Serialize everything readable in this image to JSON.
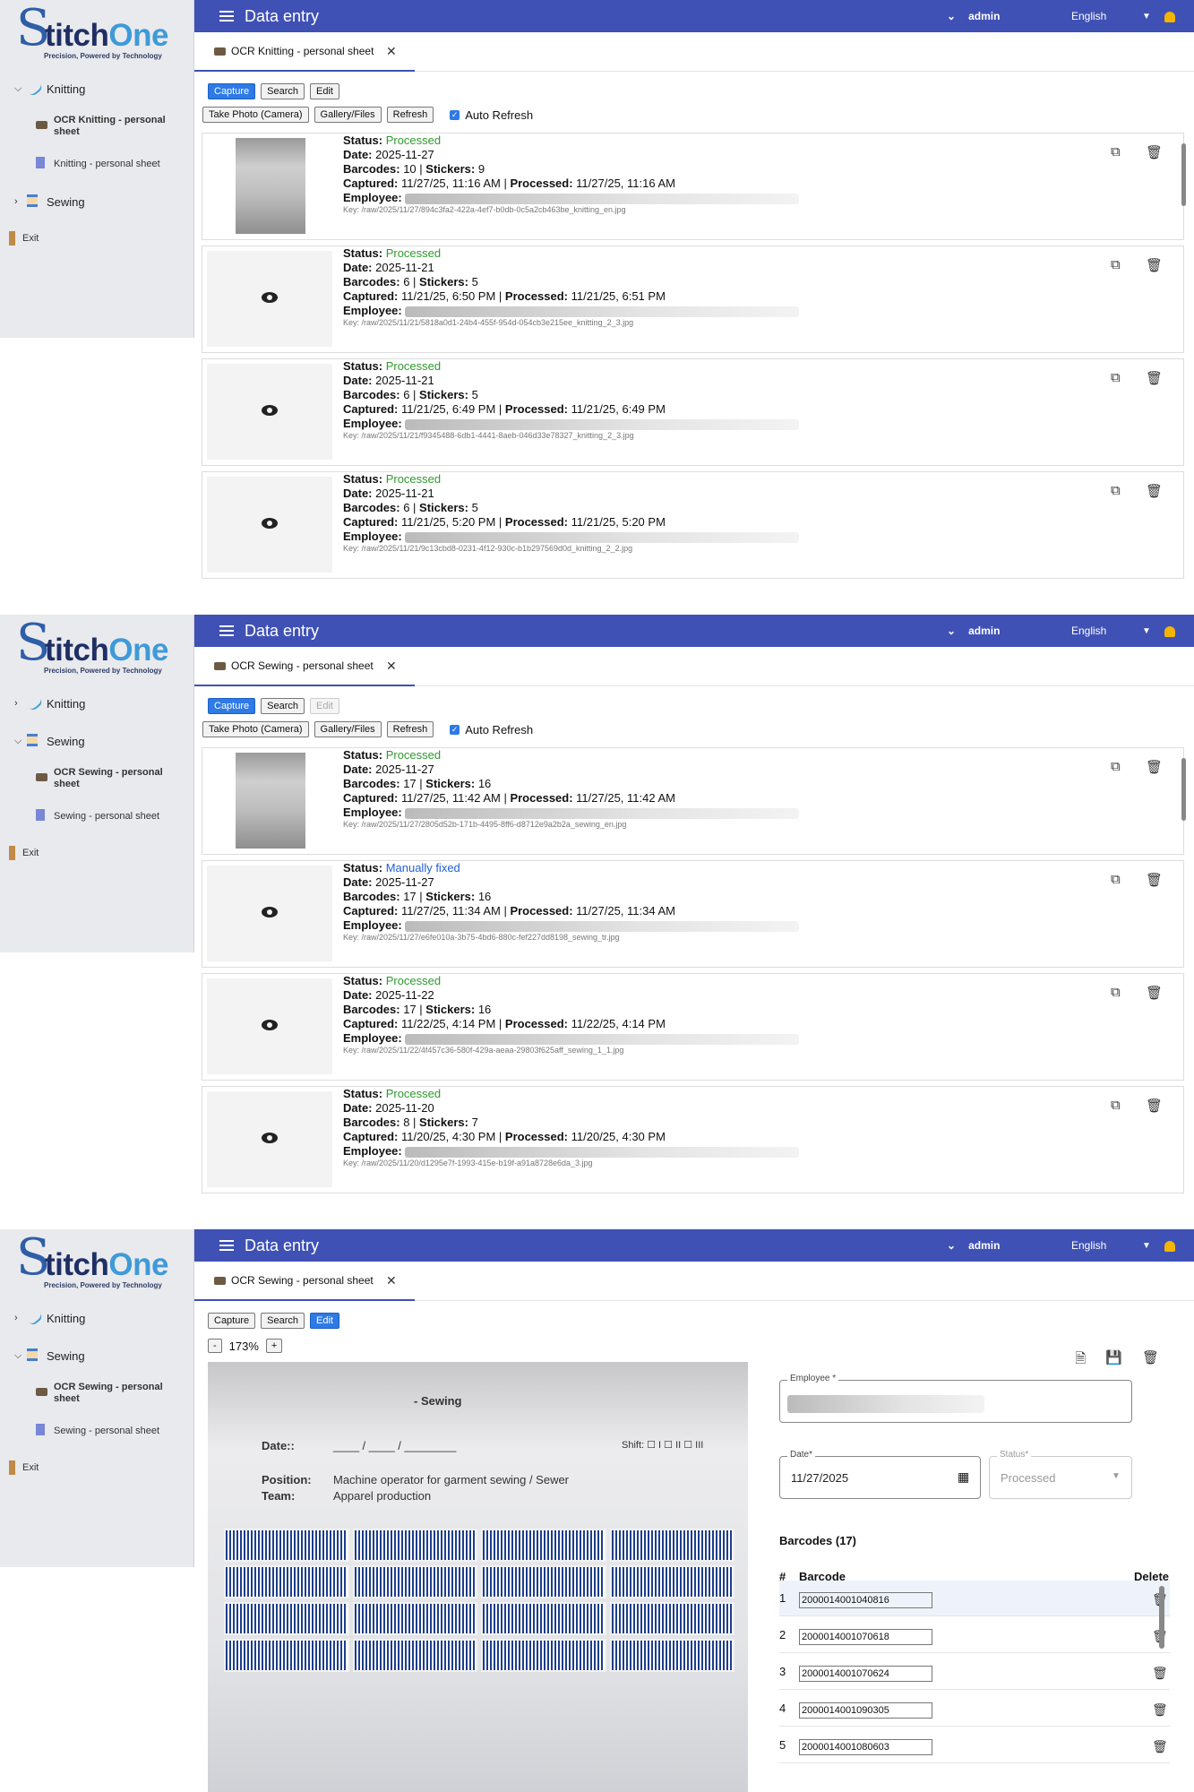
{
  "app": {
    "logo_letter": "S",
    "logo_rest": "titch",
    "logo_accent": "One",
    "tagline": "Precision, Powered by Technology",
    "title": "Data entry",
    "user": "admin",
    "language": "English",
    "brand_color": "#3f51b5",
    "accent_color": "#2e7ae6"
  },
  "nav": {
    "knitting": "Knitting",
    "sewing": "Sewing",
    "ocr_knitting": "OCR Knitting - personal sheet",
    "knitting_sheet": "Knitting - personal sheet",
    "ocr_sewing": "OCR Sewing - personal sheet",
    "sewing_sheet": "Sewing - personal sheet",
    "exit": "Exit"
  },
  "toolbar": {
    "capture": "Capture",
    "search": "Search",
    "edit": "Edit",
    "take_photo": "Take Photo (Camera)",
    "gallery": "Gallery/Files",
    "refresh": "Refresh",
    "auto_refresh": "Auto Refresh"
  },
  "labels": {
    "status": "Status:",
    "date": "Date:",
    "barcodes": "Barcodes:",
    "stickers": "Stickers:",
    "captured": "Captured:",
    "processed": "Processed:",
    "employee": "Employee:"
  },
  "panel1": {
    "tab": "OCR Knitting - personal sheet",
    "records": [
      {
        "status": "Processed",
        "date": "2025-11-27",
        "barcodes": "10",
        "stickers": "9",
        "captured": "11/27/25, 11:16 AM",
        "processed": "11/27/25, 11:16 AM",
        "key": "Key: /raw/2025/11/27/894c3fa2-422a-4ef7-b0db-0c5a2cb463be_knitting_en.jpg"
      },
      {
        "status": "Processed",
        "date": "2025-11-21",
        "barcodes": "6",
        "stickers": "5",
        "captured": "11/21/25, 6:50 PM",
        "processed": "11/21/25, 6:51 PM",
        "key": "Key: /raw/2025/11/21/5818a0d1-24b4-455f-954d-054cb3e215ee_knitting_2_3.jpg"
      },
      {
        "status": "Processed",
        "date": "2025-11-21",
        "barcodes": "6",
        "stickers": "5",
        "captured": "11/21/25, 6:49 PM",
        "processed": "11/21/25, 6:49 PM",
        "key": "Key: /raw/2025/11/21/f9345488-6db1-4441-8aeb-046d33e78327_knitting_2_3.jpg"
      },
      {
        "status": "Processed",
        "date": "2025-11-21",
        "barcodes": "6",
        "stickers": "5",
        "captured": "11/21/25, 5:20 PM",
        "processed": "11/21/25, 5:20 PM",
        "key": "Key: /raw/2025/11/21/9c13cbd8-0231-4f12-930c-b1b297569d0d_knitting_2_2.jpg"
      }
    ]
  },
  "panel2": {
    "tab": "OCR Sewing - personal sheet",
    "records": [
      {
        "status": "Processed",
        "date": "2025-11-27",
        "barcodes": "17",
        "stickers": "16",
        "captured": "11/27/25, 11:42 AM",
        "processed": "11/27/25, 11:42 AM",
        "key": "Key: /raw/2025/11/27/2805d52b-171b-4495-8ff6-d8712e9a2b2a_sewing_en.jpg"
      },
      {
        "status": "Manually fixed",
        "date": "2025-11-27",
        "barcodes": "17",
        "stickers": "16",
        "captured": "11/27/25, 11:34 AM",
        "processed": "11/27/25, 11:34 AM",
        "key": "Key: /raw/2025/11/27/e6fe010a-3b75-4bd6-880c-fef227dd8198_sewing_tr.jpg"
      },
      {
        "status": "Processed",
        "date": "2025-11-22",
        "barcodes": "17",
        "stickers": "16",
        "captured": "11/22/25, 4:14 PM",
        "processed": "11/22/25, 4:14 PM",
        "key": "Key: /raw/2025/11/22/4f457c36-580f-429a-aeaa-29803f625aff_sewing_1_1.jpg"
      },
      {
        "status": "Processed",
        "date": "2025-11-20",
        "barcodes": "8",
        "stickers": "7",
        "captured": "11/20/25, 4:30 PM",
        "processed": "11/20/25, 4:30 PM",
        "key": "Key: /raw/2025/11/20/d1295e7f-1993-415e-b19f-a91a8728e6da_3.jpg"
      }
    ]
  },
  "panel3": {
    "tab": "OCR Sewing - personal sheet",
    "zoom_minus": "-",
    "zoom": "173%",
    "zoom_plus": "+",
    "sheet": {
      "heading": "- Sewing",
      "date_label": "Date::",
      "date_blank": "____ / ____ / ________",
      "shift": "Shift: ☐ I ☐ II ☐ III",
      "position_label": "Position:",
      "position_value": "Machine operator for garment sewing / Sewer",
      "team_label": "Team:",
      "team_value": "Apparel production"
    },
    "form": {
      "employee_label": "Employee *",
      "date_label": "Date*",
      "date_value": "11/27/2025",
      "status_label": "Status*",
      "status_value": "Processed",
      "barcodes_title": "Barcodes (17)",
      "col_num": "#",
      "col_barcode": "Barcode",
      "col_delete": "Delete",
      "rows": [
        {
          "n": "1",
          "barcode": "2000014001040816"
        },
        {
          "n": "2",
          "barcode": "2000014001070618"
        },
        {
          "n": "3",
          "barcode": "2000014001070624"
        },
        {
          "n": "4",
          "barcode": "2000014001090305"
        },
        {
          "n": "5",
          "barcode": "2000014001080603"
        }
      ]
    }
  }
}
